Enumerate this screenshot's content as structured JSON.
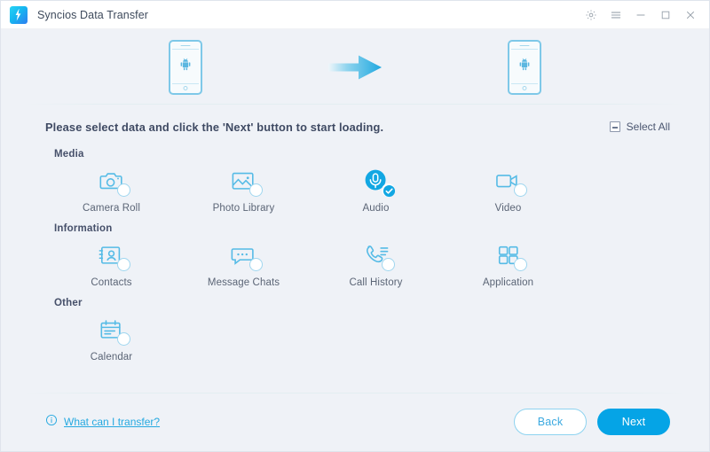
{
  "window": {
    "title": "Syncios Data Transfer",
    "logo_icon": "syncios-logo-icon",
    "controls": [
      {
        "name": "settings-button",
        "icon": "gear-icon"
      },
      {
        "name": "menu-button",
        "icon": "hamburger-menu-icon"
      },
      {
        "name": "minimize-button",
        "icon": "minimize-icon"
      },
      {
        "name": "maximize-button",
        "icon": "maximize-icon"
      },
      {
        "name": "close-button",
        "icon": "close-icon"
      }
    ]
  },
  "devices": {
    "source_icon": "android-phone-icon",
    "transfer_icon": "right-arrow-icon",
    "target_icon": "android-phone-icon"
  },
  "instruction": {
    "text": "Please select data and click the 'Next' button to start loading.",
    "select_all_label": "Select All",
    "select_all_state": "indeterminate",
    "select_all_icon": "indeterminate-checkbox-icon"
  },
  "groups": [
    {
      "title": "Media",
      "items": [
        {
          "label": "Camera Roll",
          "icon": "camera-icon",
          "selected": false
        },
        {
          "label": "Photo Library",
          "icon": "photo-icon",
          "selected": false
        },
        {
          "label": "Audio",
          "icon": "microphone-icon",
          "selected": true
        },
        {
          "label": "Video",
          "icon": "video-camera-icon",
          "selected": false
        }
      ]
    },
    {
      "title": "Information",
      "items": [
        {
          "label": "Contacts",
          "icon": "contact-card-icon",
          "selected": false
        },
        {
          "label": "Message Chats",
          "icon": "chat-bubble-icon",
          "selected": false
        },
        {
          "label": "Call History",
          "icon": "phone-call-icon",
          "selected": false
        },
        {
          "label": "Application",
          "icon": "app-grid-icon",
          "selected": false
        }
      ]
    },
    {
      "title": "Other",
      "items": [
        {
          "label": "Calendar",
          "icon": "calendar-icon",
          "selected": false
        }
      ]
    }
  ],
  "footer": {
    "help_label": "What can I transfer?",
    "help_icon": "info-circle-icon",
    "back_label": "Back",
    "next_label": "Next"
  },
  "colors": {
    "accent": "#05a4e6",
    "icon_line": "#55bbe6",
    "background": "#eff2f7",
    "titlebar": "#ffffff",
    "text_dark": "#3f4a63",
    "text_muted": "#5b6576"
  }
}
